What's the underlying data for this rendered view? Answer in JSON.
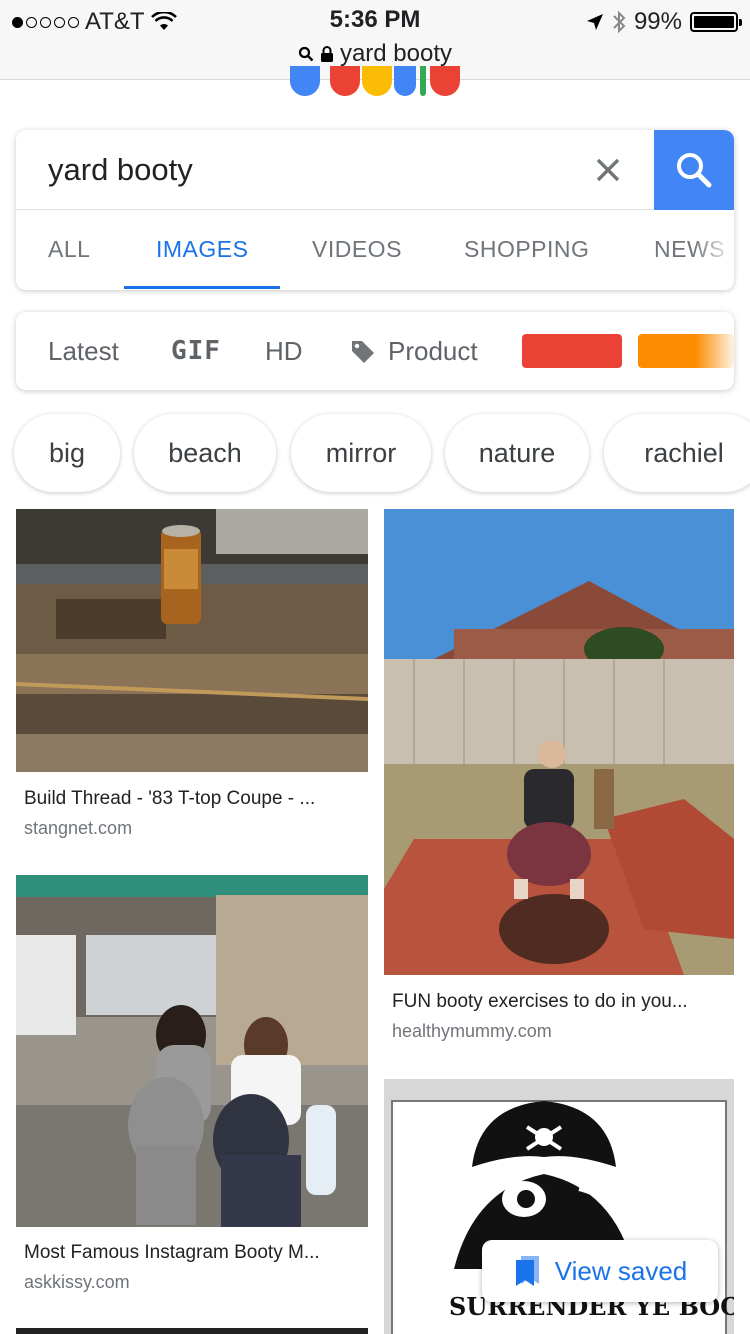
{
  "status_bar": {
    "carrier": "AT&T",
    "signal_bars_filled": 1,
    "time": "5:36 PM",
    "battery_percent": "99%",
    "battery_level": 0.99
  },
  "browser": {
    "url_text": "yard booty"
  },
  "search": {
    "query": "yard booty",
    "tabs": [
      "ALL",
      "IMAGES",
      "VIDEOS",
      "SHOPPING",
      "NEWS"
    ],
    "active_tab": "IMAGES"
  },
  "filters": {
    "items": [
      "Latest",
      "GIF",
      "HD",
      "Product"
    ],
    "colors": [
      "#ea4335",
      "#fb8c00"
    ]
  },
  "chips": [
    "big",
    "beach",
    "mirror",
    "nature",
    "rachiel"
  ],
  "results": [
    {
      "title": "Build Thread - '83 T-top Coupe - ...",
      "source": "stangnet.com"
    },
    {
      "title": "FUN booty exercises to do in you...",
      "source": "healthymummy.com"
    },
    {
      "title": "Most Famous Instagram Booty M...",
      "source": "askkissy.com"
    },
    {
      "title": "",
      "source": "",
      "image_text": "SURRENDER YE BOOTY"
    }
  ],
  "view_saved_label": "View saved",
  "theme": {
    "accent": "#1a73e8",
    "search_button": "#4285f4"
  }
}
